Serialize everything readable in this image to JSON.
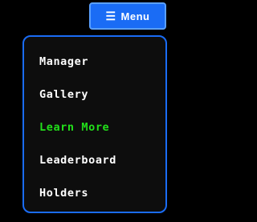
{
  "header": {
    "menu_button": {
      "icon": "hamburger-icon",
      "icon_glyph": "☰",
      "label": "Menu"
    }
  },
  "menu": {
    "items": [
      {
        "label": "Manager",
        "active": false
      },
      {
        "label": "Gallery",
        "active": false
      },
      {
        "label": "Learn More",
        "active": true
      },
      {
        "label": "Leaderboard",
        "active": false
      },
      {
        "label": "Holders",
        "active": false
      }
    ]
  },
  "colors": {
    "background": "#000000",
    "accent": "#1a6cf5",
    "active_item": "#22e01a",
    "text": "#ffffff"
  }
}
